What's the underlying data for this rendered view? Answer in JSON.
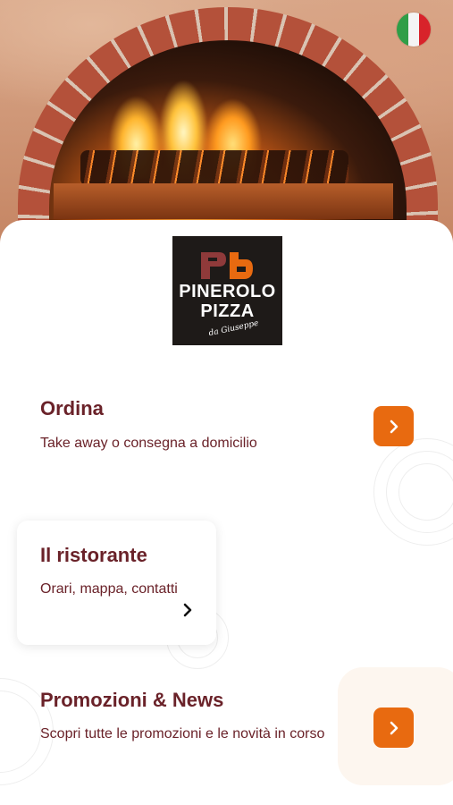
{
  "header": {
    "language_flag": "italy-flag-icon"
  },
  "logo": {
    "line1": "PINEROLO",
    "line2": "PIZZA",
    "line3": "da Giuseppe"
  },
  "menu": {
    "order": {
      "title": "Ordina",
      "subtitle": "Take away o consegna a domicilio"
    },
    "restaurant": {
      "title": "Il ristorante",
      "subtitle": "Orari, mappa, contatti"
    },
    "promotions": {
      "title": "Promozioni & News",
      "subtitle": "Scopri tutte le promozioni e le novità in corso"
    }
  },
  "colors": {
    "accent": "#e86a10",
    "text": "#6a2229",
    "logo_bg": "#1e1a18"
  }
}
